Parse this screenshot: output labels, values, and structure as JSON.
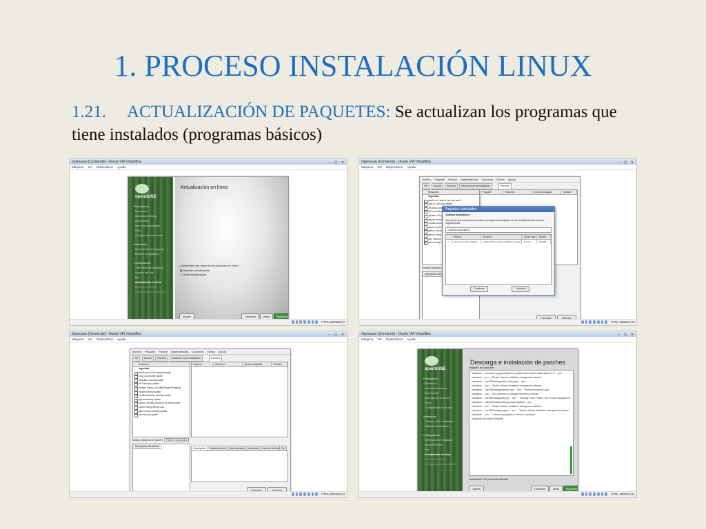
{
  "slide": {
    "title": "1. PROCESO INSTALACIÓN LINUX",
    "section_number": "1.21.",
    "section_heading": "ACTUALIZACIÓN DE PAQUETES:",
    "section_text": "Se actualizan los programas que tiene instalados (programas básicos)"
  },
  "vm": {
    "window_title": "Opensuse [Corriendo] - Oracle VM VirtualBox",
    "menu": [
      "Máquina",
      "Ver",
      "Dispositivos",
      "Ayuda"
    ],
    "host_key": "CTRL DERECHA"
  },
  "installer": {
    "logo_text": "openSUSE",
    "groups": {
      "prep": "Preparación",
      "install": "Instalación",
      "config": "Configuración"
    },
    "prep_items": [
      "Bienvenido",
      "Análisis del sistema",
      "Zona horaria",
      "Selección de escritorio",
      "Disco",
      "Configuración de usuario"
    ],
    "install_items": [
      "Resumen de la instalación",
      "Realizar la instalación"
    ],
    "config_items": [
      "Verificación de instalación",
      "Nombre del host",
      "Red",
      "Actualización en línea",
      "Notas de la versión",
      "Configuración del hardware"
    ],
    "screen1_title": "Actualización en línea",
    "question": "¿Desea ejecutar ahora la actualización en línea?",
    "options": [
      "Ejecutar actualización",
      "Omitir actualización"
    ],
    "screen4_title": "Descarga e instalación de parches",
    "log_label": "Registro de paquete",
    "log_lines": [
      "Instalando ... /var/cache/zypp/packages/repo-update/noarch/yast2-online-update-2.17 ... rpm",
      "Instalando ... rpm ... \"Simple software installation management software\"",
      "Instalando ... /var/RM/Package/x86_64/xfsprogs ... rpm",
      "Instalando ... rpm ... \"Simple software installation management software\"",
      "Instalando ... /var/RM/Package/python-zypp ... rpm ... \"Python bindings for zypp\"",
      "Instalando ... rpm ... \"Unix approach to package dependency solving\"",
      "Instalando ... /var/RM/Package/libzypp ... rpm ... \"Package, Patch, Pattern, and Product management\"",
      "Instalando ... /var/RM/Package/libzypp-plugin-appdata ... rpm",
      "Instalando ... rpm ... \"Simple software installation management software\"",
      "Instalando ... /var/RM/Package/zypper ... rpm ... \"Simple software installation management software\"",
      "Instalando ... rpm ... \"Librería de paquetes en línea de comandos\"",
      "Instalación del parche finalizada"
    ],
    "patch_done_label": "Instalación del parche finalizada",
    "btn_help": "Ayuda",
    "btn_cancel": "Cancelar",
    "btn_back": "Atrás",
    "btn_next": "Siguiente"
  },
  "patch_manager": {
    "menu": [
      "Archivo",
      "Paquete",
      "Parche",
      "Dependencias",
      "Opciones",
      "Extras",
      "Ayuda"
    ],
    "tabs": [
      "Ver",
      "Buscar",
      "Parches",
      "Resumen de la instalación",
      "Parches"
    ],
    "list_header": "Resumen",
    "list_category": "seguridad",
    "list_items": [
      "yast2-core: fixed a bug with yast2 ...",
      "xorg-x11 security update",
      "virtualbox security update",
      "MFS security update",
      "Update: Fixing Crow (Bill Request Registry)",
      "zypper security update",
      "mozilla-xulrunner security update",
      "python security update",
      "python: Security update to fix several vulns",
      "python: fixing remote code ...",
      "gtk2 / libsoup security update",
      "perl security update"
    ],
    "table_cols": [
      "Paquete",
      "Resumen",
      "Versión instalada",
      "Tamaño"
    ],
    "filter_label": "Mostrar categoría del parche:",
    "filter_value": "Parches necesarios",
    "desc_label": "Descripción del parche",
    "bottom_tabs": [
      "Descripción",
      "Datos técnicos",
      "Dependencias",
      "Versiones",
      "Lista de archivos",
      "Re"
    ],
    "btn_cancel": "Cancelar",
    "btn_accept": "Aceptar"
  },
  "dialog": {
    "title": "Paquetes cambiados",
    "subtitle": "Cambios automáticos",
    "text": "Además de las selecciones manuales, los siguientes paquetes se han modificado para resolver dependencias:",
    "combo": "Cambios automáticos",
    "cols": [
      "",
      "Paquete",
      "Resumen",
      "Versión disp.",
      "Tamaño"
    ],
    "row": [
      "",
      "opensuse-codecs-installer",
      "Codec platform codec installation for openSUSE",
      "16.0.1-1",
      "44,0 KiB"
    ],
    "btn_continue": "Continuar",
    "btn_cancel": "Cancelar"
  }
}
